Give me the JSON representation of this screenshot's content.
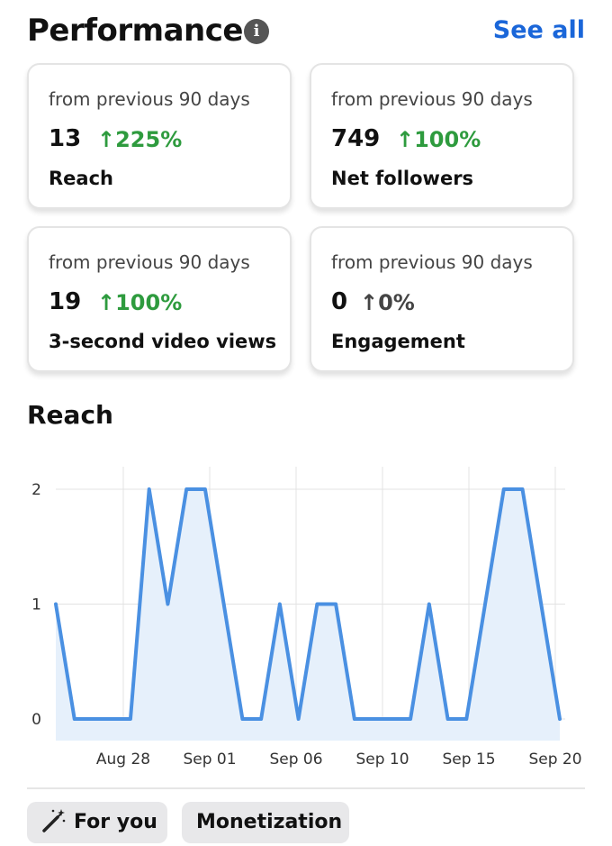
{
  "header": {
    "title": "Performance",
    "info_icon": "info-icon",
    "see_all_label": "See all",
    "accent": "#1a66d9"
  },
  "cards": [
    {
      "period": "from previous 90 days",
      "value": "13",
      "change": "↑225%",
      "change_positive": true,
      "label": "Reach"
    },
    {
      "period": "from previous 90 days",
      "value": "749",
      "change": "↑100%",
      "change_positive": true,
      "label": "Net followers"
    },
    {
      "period": "from previous 90 days",
      "value": "19",
      "change": "↑100%",
      "change_positive": true,
      "label": "3-second video views"
    },
    {
      "period": "from previous 90 days",
      "value": "0",
      "change": "↑0%",
      "change_positive": false,
      "label": "Engagement"
    }
  ],
  "chart_section": {
    "title": "Reach"
  },
  "chart_data": {
    "type": "area",
    "title": "",
    "x_ticks": [
      "Aug 28",
      "Sep 01",
      "Sep 06",
      "Sep 10",
      "Sep 15",
      "Sep 20"
    ],
    "y_ticks": [
      "0",
      "1",
      "2"
    ],
    "ylim": [
      0,
      2
    ],
    "series": [
      {
        "line_color": "#4a90e2",
        "fill_color": "#e6f0fb",
        "values": [
          1,
          0,
          0,
          0,
          0,
          2,
          1,
          2,
          2,
          1,
          0,
          0,
          1,
          0,
          1,
          1,
          0,
          0,
          0,
          0,
          1,
          0,
          0,
          1,
          2,
          2,
          1,
          0
        ]
      }
    ],
    "grid": true
  },
  "chips": [
    {
      "label": "For you",
      "icon": "magic-wand-icon"
    },
    {
      "label": "Monetization"
    }
  ],
  "colors": {
    "positive": "#2e9b3e",
    "neutral": "#444444"
  }
}
